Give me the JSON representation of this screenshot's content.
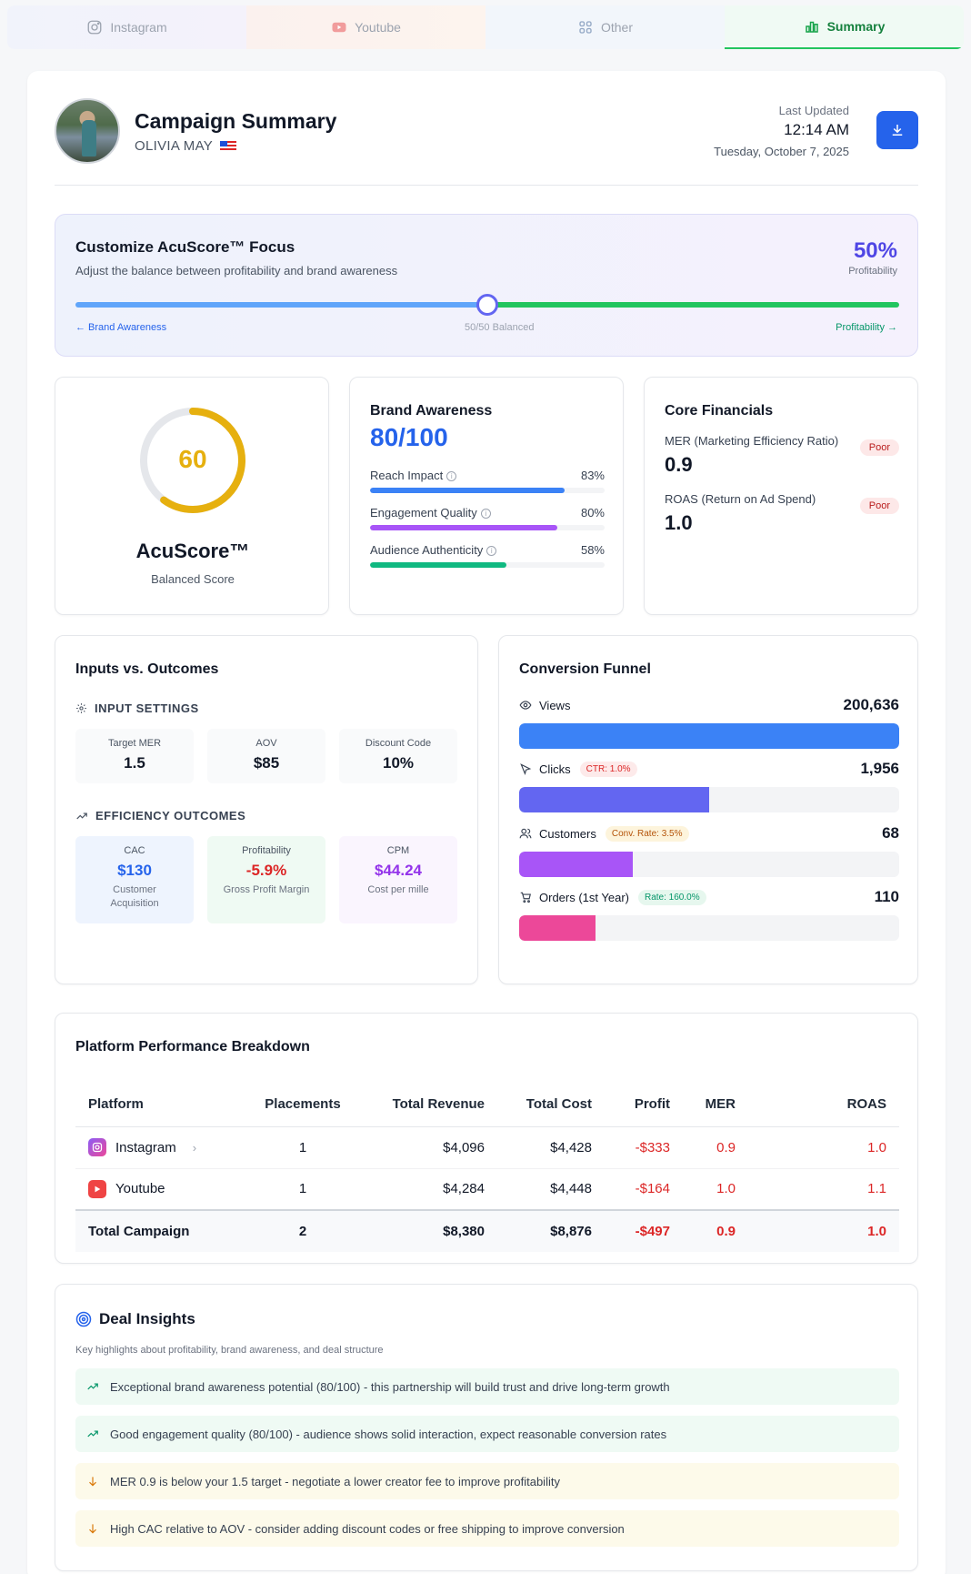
{
  "tabs": [
    {
      "label": "Instagram",
      "icon": "instagram-icon"
    },
    {
      "label": "Youtube",
      "icon": "youtube-icon"
    },
    {
      "label": "Other",
      "icon": "grid-icon"
    },
    {
      "label": "Summary",
      "icon": "bar-chart-icon",
      "active": true
    }
  ],
  "header": {
    "title": "Campaign Summary",
    "creator": "OLIVIA MAY",
    "last_updated_label": "Last Updated",
    "time": "12:14 AM",
    "date": "Tuesday, October 7, 2025"
  },
  "focus": {
    "title": "Customize AcuScore™ Focus",
    "subtitle": "Adjust the balance between profitability and brand awareness",
    "percent": "50%",
    "percent_label": "Profitability",
    "left_label": "← Brand Awareness",
    "mid_label": "50/50 Balanced",
    "right_label": "Profitability →",
    "slider_value": 0.5
  },
  "score": {
    "value": "60",
    "progress": 0.6,
    "name": "AcuScore™",
    "sub": "Balanced Score",
    "color": "#e6b00f"
  },
  "brand": {
    "title": "Brand Awareness",
    "score": "80/100",
    "metrics": [
      {
        "label": "Reach Impact",
        "value": "83%",
        "fill": 0.83,
        "color": "#3b82f6"
      },
      {
        "label": "Engagement Quality",
        "value": "80%",
        "fill": 0.8,
        "color": "#a855f7"
      },
      {
        "label": "Audience Authenticity",
        "value": "58%",
        "fill": 0.58,
        "color": "#10b981"
      }
    ]
  },
  "financials": {
    "title": "Core Financials",
    "items": [
      {
        "label": "MER (Marketing Efficiency Ratio)",
        "value": "0.9",
        "badge": "Poor"
      },
      {
        "label": "ROAS (Return on Ad Spend)",
        "value": "1.0",
        "badge": "Poor"
      }
    ]
  },
  "inputs": {
    "title": "Inputs vs. Outcomes",
    "settings_label": "INPUT SETTINGS",
    "settings": [
      {
        "label": "Target MER",
        "value": "1.5"
      },
      {
        "label": "AOV",
        "value": "$85"
      },
      {
        "label": "Discount Code",
        "value": "10%"
      }
    ],
    "outcomes_label": "EFFICIENCY OUTCOMES",
    "outcomes": [
      {
        "label": "CAC",
        "value": "$130",
        "desc": "Customer Acquisition",
        "color": "#2563eb",
        "bg": "#eef4fe"
      },
      {
        "label": "Profitability",
        "value": "-5.9%",
        "desc": "Gross Profit Margin",
        "color": "#dc2626",
        "bg": "#effaf3"
      },
      {
        "label": "CPM",
        "value": "$44.24",
        "desc": "Cost per mille",
        "color": "#9333ea",
        "bg": "#faf5fe"
      }
    ]
  },
  "funnel": {
    "title": "Conversion Funnel",
    "steps": [
      {
        "label": "Views",
        "value": "200,636",
        "fill": 1.0,
        "color": "#3b82f6",
        "icon": "eye-icon",
        "tag": ""
      },
      {
        "label": "Clicks",
        "value": "1,956",
        "fill": 0.5,
        "color": "#6366f1",
        "icon": "cursor-icon",
        "tag": "CTR: 1.0%",
        "tag_color": "#dc2626",
        "tag_bg": "#fdeaea"
      },
      {
        "label": "Customers",
        "value": "68",
        "fill": 0.3,
        "color": "#a855f7",
        "icon": "users-icon",
        "tag": "Conv. Rate: 3.5%",
        "tag_color": "#b45309",
        "tag_bg": "#fdf4dc"
      },
      {
        "label": "Orders (1st Year)",
        "value": "110",
        "fill": 0.2,
        "color": "#ec4899",
        "icon": "cart-icon",
        "tag": "Rate: 160.0%",
        "tag_color": "#059669",
        "tag_bg": "#e6f7ee"
      }
    ]
  },
  "platform": {
    "title": "Platform Performance Breakdown",
    "columns": [
      "Platform",
      "Placements",
      "Total Revenue",
      "Total Cost",
      "Profit",
      "MER",
      "ROAS"
    ],
    "rows": [
      {
        "platform": "Instagram",
        "placements": "1",
        "revenue": "$4,096",
        "cost": "$4,428",
        "profit": "-$333",
        "mer": "0.9",
        "roas": "1.0"
      },
      {
        "platform": "Youtube",
        "placements": "1",
        "revenue": "$4,284",
        "cost": "$4,448",
        "profit": "-$164",
        "mer": "1.0",
        "roas": "1.1"
      }
    ],
    "total": {
      "platform": "Total Campaign",
      "placements": "2",
      "revenue": "$8,380",
      "cost": "$8,876",
      "profit": "-$497",
      "mer": "0.9",
      "roas": "1.0"
    }
  },
  "insights": {
    "title": "Deal Insights",
    "subtitle": "Key highlights about profitability, brand awareness, and deal structure",
    "items": [
      {
        "type": "good",
        "text": "Exceptional brand awareness potential (80/100) - this partnership will build trust and drive long-term growth"
      },
      {
        "type": "good",
        "text": "Good engagement quality (80/100) - audience shows solid interaction, expect reasonable conversion rates"
      },
      {
        "type": "warn",
        "text": "MER 0.9 is below your 1.5 target - negotiate a lower creator fee to improve profitability"
      },
      {
        "type": "warn",
        "text": "High CAC relative to AOV - consider adding discount codes or free shipping to improve conversion"
      }
    ]
  }
}
